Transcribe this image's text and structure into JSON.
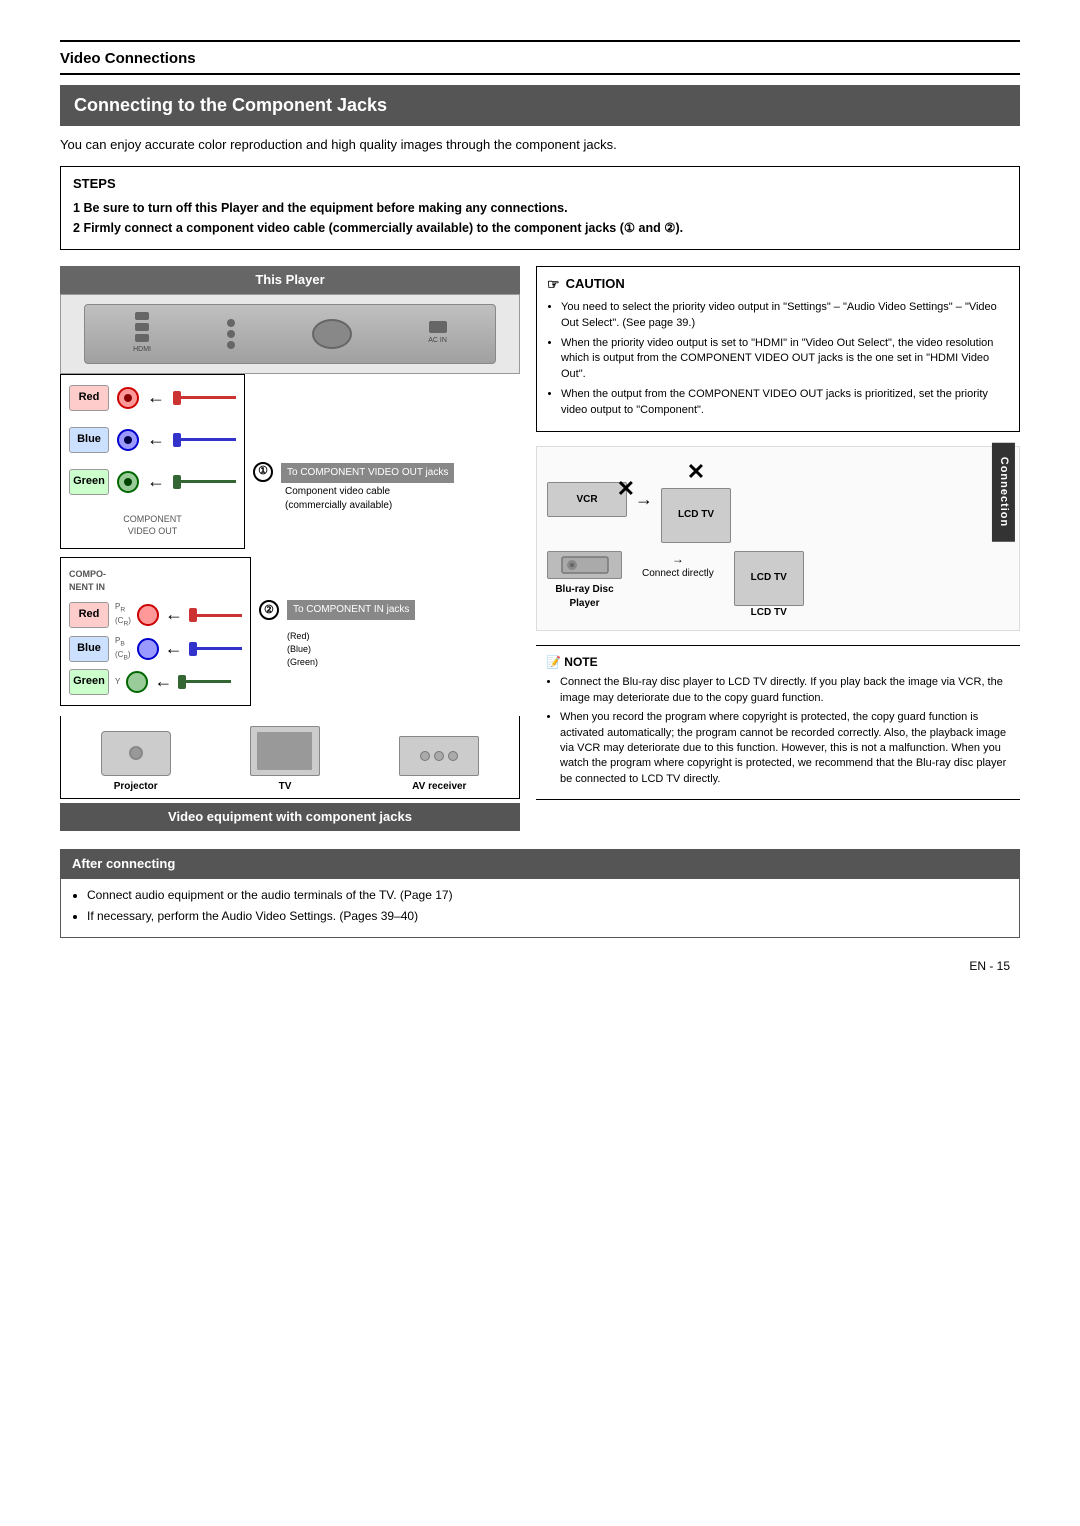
{
  "page": {
    "section_title": "Video Connections",
    "heading": "Connecting to the Component Jacks",
    "intro": "You can enjoy accurate color reproduction and high quality images through the component jacks.",
    "steps": {
      "title": "STEPS",
      "step1": "Be sure to turn off this Player and the equipment before making any connections.",
      "step2": "Firmly connect a component video cable (commercially available) to the component jacks (① and ②)."
    },
    "this_player_label": "This Player",
    "caution": {
      "title": "CAUTION",
      "items": [
        "You need to select the priority video output in \"Settings\" – \"Audio Video Settings\" – \"Video Out Select\". (See page 39.)",
        "When the priority video output is set to \"HDMI\" in \"Video Out Select\", the video resolution which is output from the COMPONENT VIDEO OUT jacks is the one set in \"HDMI Video Out\".",
        "When the output from the COMPONENT VIDEO OUT jacks is prioritized, set the priority video output to \"Component\"."
      ]
    },
    "note": {
      "title": "NOTE",
      "items": [
        "Connect the Blu-ray disc player to LCD TV directly. If you play back the image via VCR, the image may deteriorate due to the copy guard function.",
        "When you record the program where copyright is protected, the copy guard function is activated automatically; the program cannot be recorded correctly. Also, the playback image via VCR may deteriorate due to this function. However, this is not a malfunction. When you watch the program where copyright is protected, we recommend that the Blu-ray disc player be connected to LCD TV directly."
      ]
    },
    "step1_label": "To COMPONENT VIDEO OUT jacks",
    "step2_label": "To COMPONENT IN jacks",
    "cable_note": "Component video cable\n(commercially available)",
    "jacks": {
      "red": "Red",
      "blue": "Blue",
      "green": "Green"
    },
    "devices": {
      "vcr": "VCR",
      "bluray": "Blu-ray Disc\nPlayer",
      "lcd_tv": "LCD TV",
      "projector": "Projector",
      "tv": "TV",
      "av_receiver": "AV receiver"
    },
    "connect_directly": "Connect directly",
    "video_equip_label": "Video equipment with component jacks",
    "after_connecting": {
      "title": "After connecting",
      "items": [
        "Connect audio equipment or the audio terminals of the TV. (Page 17)",
        "If necessary, perform the Audio Video Settings. (Pages 39–40)"
      ]
    },
    "connection_sidebar": "Connection",
    "page_number": "EN - 15"
  }
}
